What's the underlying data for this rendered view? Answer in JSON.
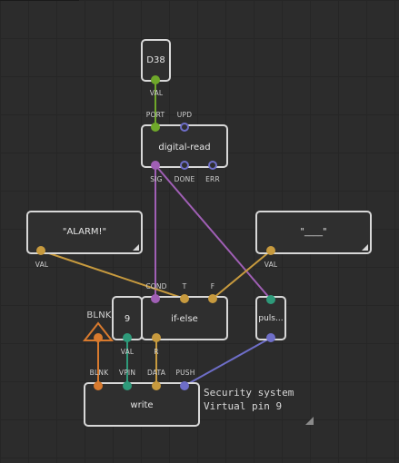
{
  "colors": {
    "green": "#6fa82a",
    "purple": "#a05fb5",
    "orange": "#d87a2e",
    "yellow": "#c79a3e",
    "teal": "#2e9a7a",
    "blue": "#6e6ec8"
  },
  "nodes": {
    "d38": {
      "title": "D38",
      "pin_val": "VAL"
    },
    "digital_read": {
      "title": "digital-read",
      "pins_top": [
        "PORT",
        "UPD"
      ],
      "pins_bottom": [
        "SIG",
        "DONE",
        "ERR"
      ]
    },
    "alarm": {
      "title": "\"ALARM!\"",
      "pin_val": "VAL"
    },
    "blank_string": {
      "title": "\"____\"",
      "pin_val": "VAL"
    },
    "if_else": {
      "title": "if-else",
      "pins_top": [
        "COND",
        "T",
        "F"
      ],
      "pin_bottom": "R"
    },
    "virtual_pin": {
      "title": "9",
      "pin_val": "VAL"
    },
    "pulse": {
      "title": "puls..."
    },
    "blink_marker": {
      "title": "BLNK"
    },
    "write": {
      "title": "write",
      "pins_top": [
        "BLNK",
        "VPIN",
        "DATA",
        "PUSH"
      ]
    }
  },
  "comment": {
    "line1": "Security system",
    "line2": "Virtual pin 9"
  }
}
